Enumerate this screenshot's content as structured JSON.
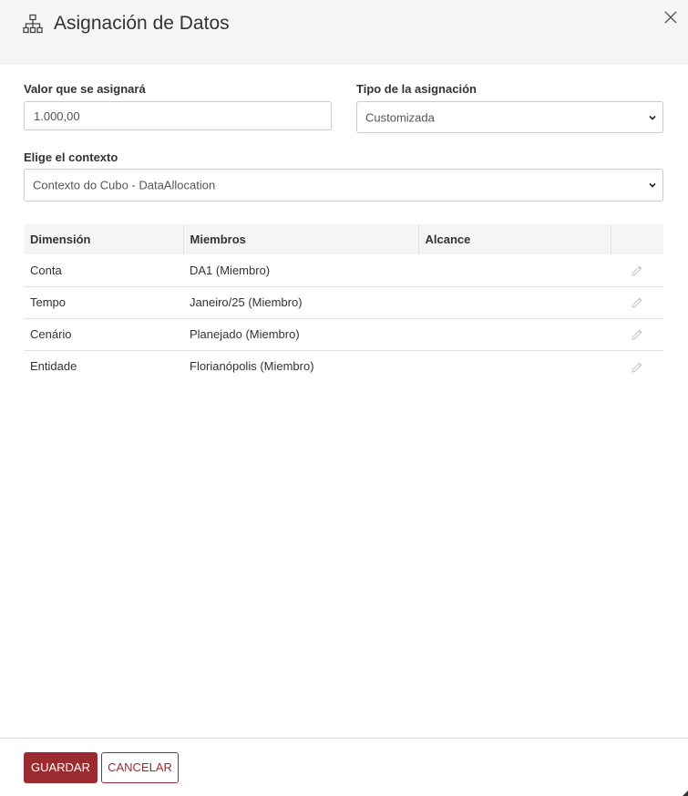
{
  "dialog": {
    "title": "Asignación de Datos",
    "icon": "sitemap-icon",
    "close_icon": "close-icon"
  },
  "form": {
    "value_label": "Valor que se asignará",
    "value": "1.000,00",
    "type_label": "Tipo de la asignación",
    "type_selected": "Customizada",
    "context_label": "Elige el contexto",
    "context_selected": "Contexto do Cubo - DataAllocation"
  },
  "table": {
    "headers": {
      "dimension": "Dimensión",
      "members": "Miembros",
      "scope": "Alcance"
    },
    "rows": [
      {
        "dimension": "Conta",
        "members": "DA1 (Miembro)",
        "scope": ""
      },
      {
        "dimension": "Tempo",
        "members": "Janeiro/25 (Miembro)",
        "scope": ""
      },
      {
        "dimension": "Cenário",
        "members": "Planejado (Miembro)",
        "scope": ""
      },
      {
        "dimension": "Entidade",
        "members": "Florianópolis (Miembro)",
        "scope": ""
      }
    ],
    "row_action_icon": "pencil-icon"
  },
  "footer": {
    "save_label": "GUARDAR",
    "cancel_label": "CANCELAR"
  },
  "colors": {
    "accent": "#9b2b30",
    "header_bg": "#f5f5f5",
    "border": "#cccccc"
  }
}
